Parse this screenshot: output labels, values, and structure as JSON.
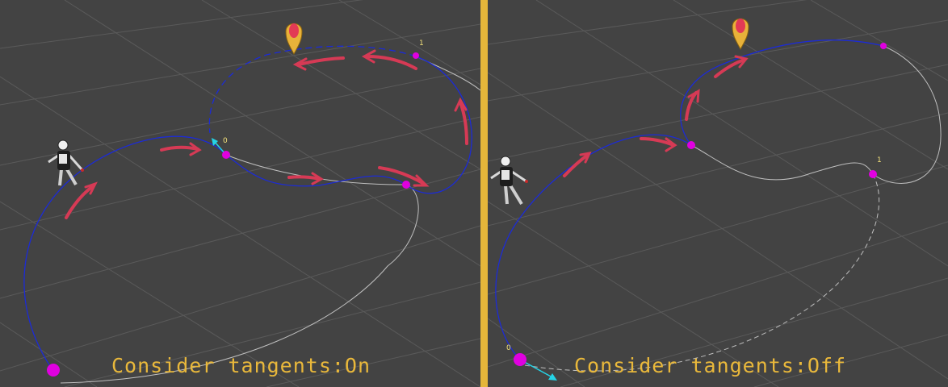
{
  "panels": {
    "left": {
      "caption": "Consider tangents:On",
      "labels": {
        "wp0": "0",
        "wp1": "1"
      }
    },
    "right": {
      "caption": "Consider tangents:Off",
      "labels": {
        "wp0": "0",
        "wp1": "1"
      }
    }
  },
  "colors": {
    "background": "#434343",
    "grid": "#5a5a5a",
    "path": "#1c2bd6",
    "ghost_path": "#bfbfbf",
    "waypoint": "#e000e0",
    "arrow": "#d63a55",
    "tangent": "#25d3e6",
    "divider": "#e5b63a",
    "caption": "#e9b83b",
    "marker_outer": "#e8b23a",
    "marker_inner": "#e23a55"
  },
  "icons": {
    "character": "robot-character-icon",
    "marker": "map-pin-icon"
  }
}
